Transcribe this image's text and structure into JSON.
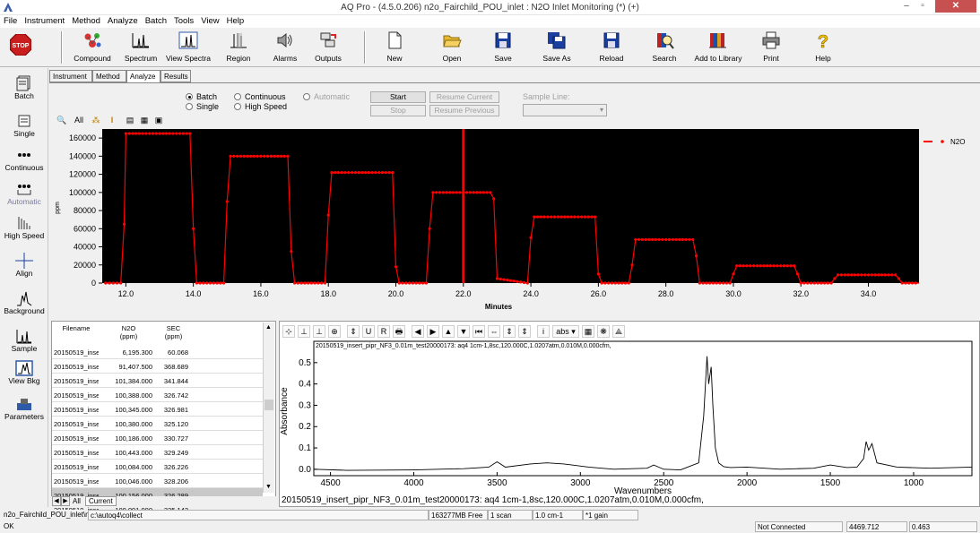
{
  "window": {
    "title": "AQ Pro -  (4.5.0.206) n2o_Fairchild_POU_inlet : N2O Inlet Monitoring (*) (+)",
    "controls": {
      "minimize": "–",
      "maximize": "▫",
      "close": "✕"
    }
  },
  "menu": [
    "File",
    "Instrument",
    "Method",
    "Analyze",
    "Batch",
    "Tools",
    "View",
    "Help"
  ],
  "toolbar": {
    "stop": "STOP",
    "buttons": [
      {
        "label": "Compound",
        "icon": "compound-icon"
      },
      {
        "label": "Spectrum",
        "icon": "spectrum-icon"
      },
      {
        "label": "View Spectra",
        "icon": "view-spectra-icon"
      },
      {
        "label": "Region",
        "icon": "region-icon"
      },
      {
        "label": "Alarms",
        "icon": "alarm-speaker-icon"
      },
      {
        "label": "Outputs",
        "icon": "outputs-icon"
      },
      {
        "label": "New",
        "icon": "new-document-icon"
      },
      {
        "label": "Open",
        "icon": "open-folder-icon"
      },
      {
        "label": "Save",
        "icon": "save-disk-icon"
      },
      {
        "label": "Save As",
        "icon": "save-as-icon"
      },
      {
        "label": "Reload",
        "icon": "reload-disk-icon"
      },
      {
        "label": "Search",
        "icon": "search-books-icon"
      },
      {
        "label": "Add to Library",
        "icon": "add-library-icon"
      },
      {
        "label": "Print",
        "icon": "printer-icon"
      },
      {
        "label": "Help",
        "icon": "help-question-icon"
      }
    ]
  },
  "sidebar": {
    "items": [
      {
        "label": "Batch",
        "icon": "batch-icon"
      },
      {
        "label": "Single",
        "icon": "single-icon"
      },
      {
        "label": "Continuous",
        "icon": "continuous-icon"
      },
      {
        "label": "Automatic",
        "icon": "automatic-icon"
      },
      {
        "label": "High Speed",
        "icon": "high-speed-icon"
      },
      {
        "label": "Align",
        "icon": "align-crosshair-icon"
      },
      {
        "label": "Background",
        "icon": "background-spectrum-icon"
      },
      {
        "label": "Sample",
        "icon": "sample-spectrum-icon"
      },
      {
        "label": "View Bkg",
        "icon": "view-bkg-icon"
      },
      {
        "label": "Parameters",
        "icon": "parameters-icon"
      }
    ]
  },
  "tabs": [
    "Instrument",
    "Method",
    "Analyze",
    "Results"
  ],
  "active_tab": "Analyze",
  "analyze": {
    "modes": {
      "batch": "Batch",
      "single": "Single",
      "continuous": "Continuous",
      "high_speed": "High Speed",
      "automatic": "Automatic",
      "selected": "Batch"
    },
    "buttons": {
      "start": "Start",
      "stop": "Stop",
      "resume_current": "Resume Current",
      "resume_previous": "Resume Previous"
    },
    "sample_line_label": "Sample Line:",
    "sample_line_value": "",
    "small_tools": [
      "🔍",
      "All",
      "⁂",
      "I",
      "▤",
      "▦",
      "▣"
    ]
  },
  "chart_data": [
    {
      "type": "line",
      "title": "",
      "xlabel": "Minutes",
      "ylabel": "ppm",
      "xlim": [
        11.3,
        35.5
      ],
      "ylim": [
        0,
        170000
      ],
      "xticks": [
        "12.0",
        "14.0",
        "16.0",
        "18.0",
        "20.0",
        "22.0",
        "24.0",
        "26.0",
        "28.0",
        "30.0",
        "32.0",
        "34.0"
      ],
      "yticks": [
        "0",
        "20000",
        "40000",
        "60000",
        "80000",
        "100000",
        "120000",
        "140000",
        "160000"
      ],
      "grid": false,
      "legend": "right",
      "cursor_x": 22.0,
      "series": [
        {
          "name": "N2O",
          "color": "#ff0000",
          "x": [
            11.4,
            11.85,
            11.95,
            12.0,
            13.9,
            14.0,
            14.1,
            14.9,
            15.0,
            15.1,
            16.8,
            16.9,
            17.0,
            17.9,
            18.0,
            18.1,
            19.9,
            20.0,
            20.1,
            20.9,
            21.0,
            21.1,
            22.8,
            22.9,
            23.0,
            23.9,
            24.0,
            24.1,
            25.9,
            26.0,
            26.1,
            26.9,
            27.0,
            27.1,
            28.8,
            28.9,
            29.0,
            29.9,
            30.0,
            30.1,
            31.8,
            31.9,
            32.0,
            32.9,
            33.0,
            33.1,
            34.8,
            34.9,
            35.0,
            35.5
          ],
          "y": [
            0,
            0,
            65000,
            165000,
            165000,
            60000,
            0,
            0,
            90000,
            140000,
            140000,
            35000,
            0,
            0,
            75000,
            122000,
            122000,
            18000,
            0,
            0,
            60000,
            100000,
            100000,
            93000,
            5000,
            0,
            50000,
            73000,
            73000,
            10000,
            0,
            0,
            20000,
            48000,
            48000,
            30000,
            0,
            0,
            10000,
            19000,
            19000,
            10000,
            0,
            0,
            5000,
            9000,
            9000,
            5000,
            0,
            0
          ]
        }
      ]
    },
    {
      "type": "line",
      "title": "20150519_insert_pipr_NF3_0.01m_test20000173: aq4 1cm-1,8sc,120.000C,1.0207atm,0.010M,0.000cfm,",
      "xlabel": "Wavenumbers",
      "ylabel": "Absorbance",
      "xlim": [
        4600,
        650
      ],
      "ylim": [
        -0.03,
        0.6
      ],
      "xticks": [
        "4500",
        "4000",
        "3500",
        "3000",
        "2500",
        "2000",
        "1500",
        "1000"
      ],
      "yticks": [
        "0.0",
        "0.1",
        "0.2",
        "0.3",
        "0.4",
        "0.5"
      ],
      "grid": false,
      "series": [
        {
          "name": "",
          "color": "#000000",
          "x": [
            4600,
            4400,
            4000,
            3700,
            3550,
            3500,
            3450,
            3300,
            3200,
            3100,
            2950,
            2800,
            2600,
            2560,
            2500,
            2400,
            2290,
            2260,
            2240,
            2230,
            2215,
            2205,
            2190,
            2170,
            2140,
            2100,
            2000,
            1800,
            1600,
            1500,
            1400,
            1340,
            1300,
            1285,
            1270,
            1250,
            1220,
            1100,
            900,
            650
          ],
          "y": [
            0.0,
            -0.005,
            -0.003,
            0.003,
            0.01,
            0.035,
            0.01,
            0.025,
            0.03,
            0.025,
            0.01,
            0.0,
            0.005,
            0.02,
            0.0,
            -0.003,
            0.03,
            0.25,
            0.53,
            0.4,
            0.48,
            0.3,
            0.1,
            0.03,
            0.012,
            0.008,
            0.01,
            0.0,
            0.005,
            0.02,
            0.008,
            0.01,
            0.05,
            0.13,
            0.09,
            0.12,
            0.03,
            0.01,
            0.005,
            0.01
          ]
        }
      ]
    }
  ],
  "trend_legend": "N2O",
  "table": {
    "headers": [
      {
        "name": "Filename",
        "unit": ""
      },
      {
        "name": "N2O",
        "unit": "(ppm)"
      },
      {
        "name": "SEC",
        "unit": "(ppm)"
      }
    ],
    "rows": [
      {
        "filename": "20150519_inse",
        "n2o": "6,195.300",
        "sec": "60.068"
      },
      {
        "filename": "20150519_inse",
        "n2o": "91,407.500",
        "sec": "368.689"
      },
      {
        "filename": "20150519_inse",
        "n2o": "101,384.000",
        "sec": "341.844"
      },
      {
        "filename": "20150519_inse",
        "n2o": "100,388.000",
        "sec": "326.742"
      },
      {
        "filename": "20150519_inse",
        "n2o": "100,345.000",
        "sec": "326.981"
      },
      {
        "filename": "20150519_inse",
        "n2o": "100,380.000",
        "sec": "325.120"
      },
      {
        "filename": "20150519_inse",
        "n2o": "100,186.000",
        "sec": "330.727"
      },
      {
        "filename": "20150519_inse",
        "n2o": "100,443.000",
        "sec": "329.249"
      },
      {
        "filename": "20150519_inse",
        "n2o": "100,084.000",
        "sec": "326.226"
      },
      {
        "filename": "20150519_inse",
        "n2o": "100,046.000",
        "sec": "328.206"
      },
      {
        "filename": "20150519_inse",
        "n2o": "100,156.000",
        "sec": "326.289"
      },
      {
        "filename": "20150519_inse",
        "n2o": "100,091.000",
        "sec": "325.143"
      }
    ],
    "selected_row": 10,
    "sheet_tabs": [
      "All",
      "Current"
    ]
  },
  "spectrum": {
    "toolbar": [
      "⊹",
      "⊥",
      "⊥",
      "⊕",
      "⇕",
      "U",
      "R",
      "🖶",
      "◀",
      "▶",
      "▲",
      "▼",
      "⏮",
      "⇔",
      "⇕",
      "⇕",
      "i",
      "abs ▾",
      "▦",
      "❋",
      "⟁"
    ],
    "caption": "20150519_insert_pipr_NF3_0.01m_test20000173: aq4 1cm-1,8sc,120.000C,1.0207atm,0.010M,0.000cfm,"
  },
  "status": {
    "file_path": "n2o_Fairchild_POU_inlet\\n2o_F",
    "collect_path": "c:\\autoq4\\collect",
    "free_space": "163277MB Free",
    "scans": "1 scan",
    "resolution": "1.0 cm-1",
    "gain": "*1 gain",
    "message": "OK",
    "connection": "Not Connected",
    "value1": "4469.712",
    "value2": "0.463"
  }
}
